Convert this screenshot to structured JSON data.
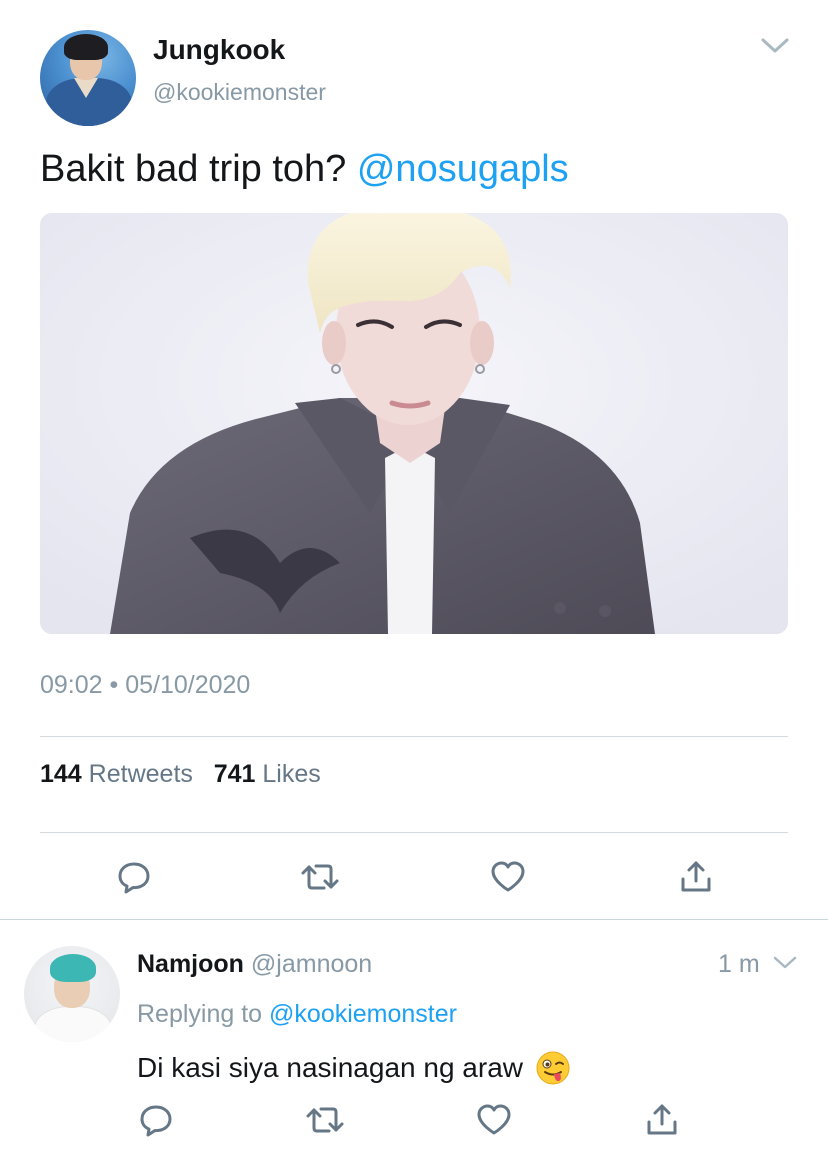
{
  "tweet": {
    "author_name": "Jungkook",
    "author_handle": "@kookiemonster",
    "text": "Bakit bad trip toh? ",
    "mention": "@nosugapls",
    "timestamp": "09:02 • 05/10/2020",
    "retweets_count": "144",
    "retweets_label": "Retweets",
    "likes_count": "741",
    "likes_label": "Likes",
    "media_alt": "photo"
  },
  "reply": {
    "author_name": "Namjoon",
    "author_handle": "@jamnoon",
    "time": "1 m",
    "replying_prefix": "Replying to ",
    "replying_handle": "@kookiemonster",
    "text": "Di kasi siya nasinagan ng araw",
    "emoji": "winking-face-with-tongue"
  },
  "icons": {
    "reply": "reply-icon",
    "retweet": "retweet-icon",
    "like": "heart-icon",
    "share": "share-icon",
    "more": "chevron-down-icon"
  },
  "colors": {
    "link": "#1da1f2",
    "secondary_text": "#8899a6",
    "primary_text": "#14171a",
    "icon": "#657786",
    "divider": "#d5dadf"
  }
}
